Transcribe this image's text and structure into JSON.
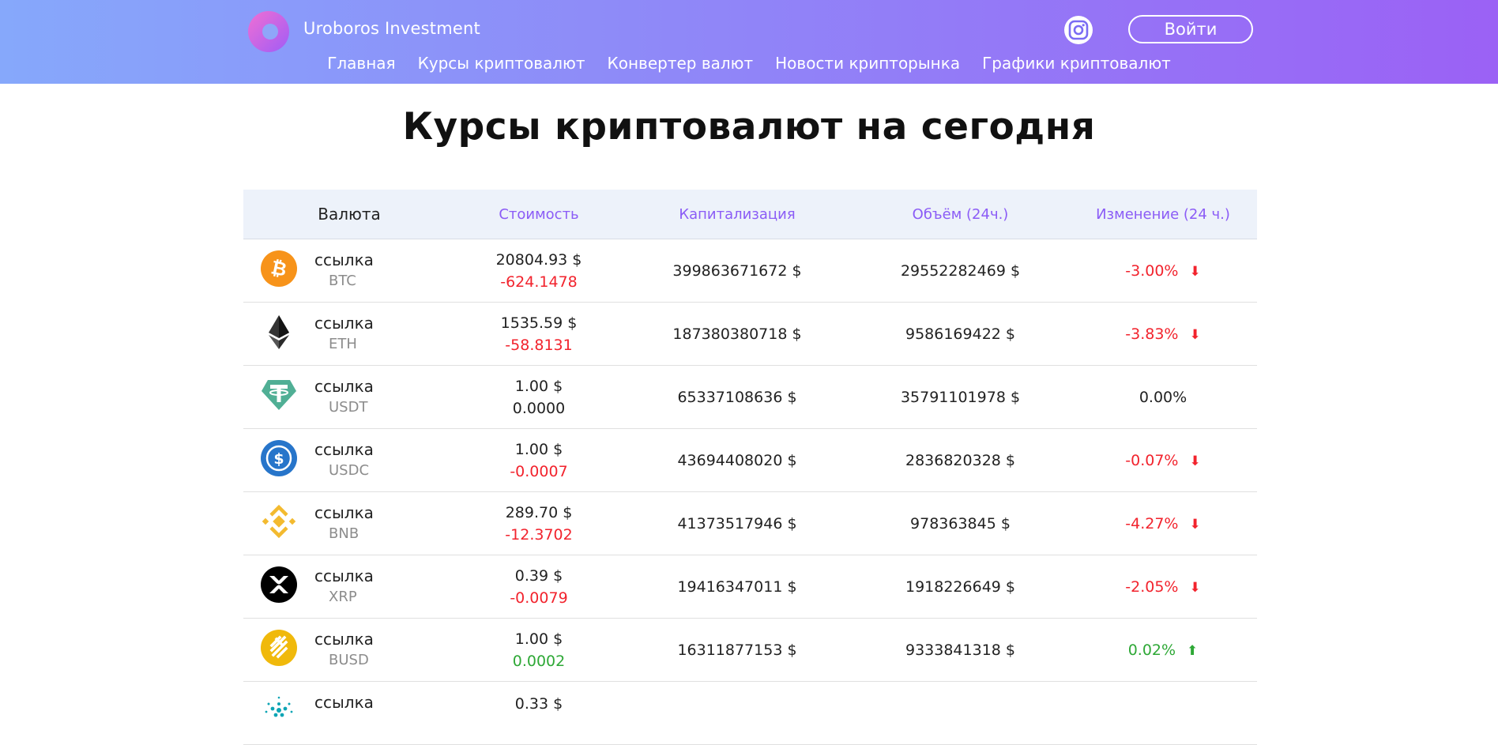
{
  "header": {
    "brand": "Uroboros Investment",
    "login_label": "Войти",
    "nav": [
      "Главная",
      "Курсы криптовалют",
      "Конвертер валют",
      "Новости крипторынка",
      "Графики криптовалют"
    ]
  },
  "page_title": "Курсы криптовалют на сегодня",
  "table": {
    "headers": [
      "Валюта",
      "Стоимость",
      "Капитализация",
      "Объём (24ч.)",
      "Изменение (24 ч.)"
    ],
    "rows": [
      {
        "link": "ссылка",
        "symbol": "BTC",
        "price": "20804.93 $",
        "price_change": "-624.1478",
        "cap": "399863671672 $",
        "volume": "29552282469 $",
        "change": "-3.00%",
        "direction": "down",
        "icon": "bitcoin-icon"
      },
      {
        "link": "ссылка",
        "symbol": "ETH",
        "price": "1535.59 $",
        "price_change": "-58.8131",
        "cap": "187380380718 $",
        "volume": "9586169422 $",
        "change": "-3.83%",
        "direction": "down",
        "icon": "ethereum-icon"
      },
      {
        "link": "ссылка",
        "symbol": "USDT",
        "price": "1.00 $",
        "price_change": "0.0000",
        "cap": "65337108636 $",
        "volume": "35791101978 $",
        "change": "0.00%",
        "direction": "none",
        "icon": "tether-icon"
      },
      {
        "link": "ссылка",
        "symbol": "USDC",
        "price": "1.00 $",
        "price_change": "-0.0007",
        "cap": "43694408020 $",
        "volume": "2836820328 $",
        "change": "-0.07%",
        "direction": "down",
        "icon": "usdc-icon"
      },
      {
        "link": "ссылка",
        "symbol": "BNB",
        "price": "289.70 $",
        "price_change": "-12.3702",
        "cap": "41373517946 $",
        "volume": "978363845 $",
        "change": "-4.27%",
        "direction": "down",
        "icon": "bnb-icon"
      },
      {
        "link": "ссылка",
        "symbol": "XRP",
        "price": "0.39 $",
        "price_change": "-0.0079",
        "cap": "19416347011 $",
        "volume": "1918226649 $",
        "change": "-2.05%",
        "direction": "down",
        "icon": "xrp-icon"
      },
      {
        "link": "ссылка",
        "symbol": "BUSD",
        "price": "1.00 $",
        "price_change": "0.0002",
        "cap": "16311877153 $",
        "volume": "9333841318 $",
        "change": "0.02%",
        "direction": "up",
        "icon": "busd-icon"
      },
      {
        "link": "ссылка",
        "symbol": "",
        "price": "0.33 $",
        "price_change": "",
        "cap": "",
        "volume": "",
        "change": "",
        "direction": "none",
        "icon": "cardano-icon"
      }
    ]
  },
  "colors": {
    "negative": "#f2232d",
    "positive": "#2ea836",
    "header_accent": "#8b5cf6",
    "btc": "#f7931a",
    "eth": "#343434",
    "usdt": "#50af95",
    "usdc": "#2775ca",
    "bnb": "#f3ba2f",
    "xrp": "#000000",
    "busd": "#f0b90b",
    "ada": "#0ea5b5"
  }
}
